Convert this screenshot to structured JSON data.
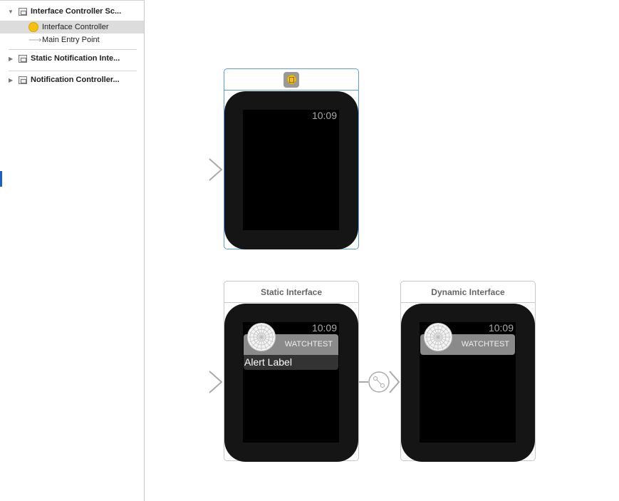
{
  "sidebar": {
    "items": [
      {
        "label": "Interface Controller Sc...",
        "icon": "scene-icon",
        "expanded": true
      },
      {
        "label": "Interface Controller",
        "icon": "interface-controller-icon",
        "selected": true
      },
      {
        "label": "Main Entry Point",
        "icon": "entry-arrow-icon"
      },
      {
        "label": "Static Notification Inte...",
        "icon": "scene-icon",
        "expanded": false
      },
      {
        "label": "Notification Controller...",
        "icon": "scene-icon",
        "expanded": false
      }
    ]
  },
  "scenes": {
    "main": {
      "time": "10:09"
    },
    "static": {
      "title": "Static Interface",
      "time": "10:09",
      "app": "WATCHTEST",
      "alert": "Alert Label"
    },
    "dynamic": {
      "title": "Dynamic Interface",
      "time": "10:09",
      "app": "WATCHTEST"
    }
  },
  "colors": {
    "selection": "#5b9be0",
    "controller_icon": "#f4c20d"
  }
}
